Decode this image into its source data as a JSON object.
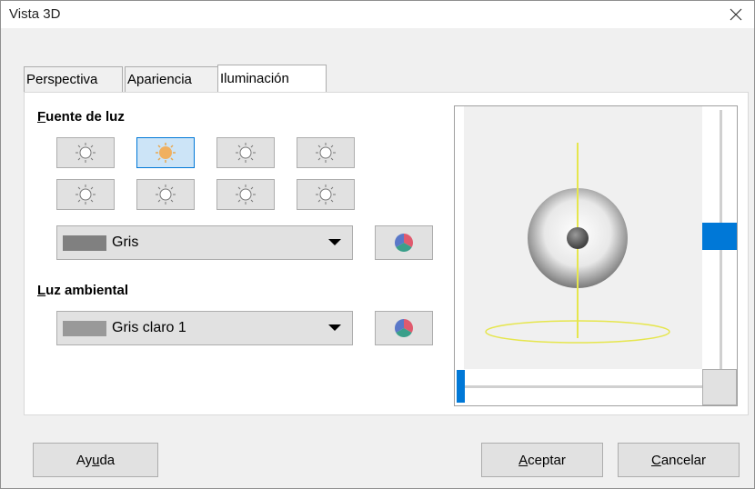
{
  "window": {
    "title": "Vista 3D"
  },
  "tabs": [
    {
      "label": "Perspectiva"
    },
    {
      "label": "Apariencia"
    },
    {
      "label": "Iluminación",
      "active": true
    }
  ],
  "light_source": {
    "label_first": "F",
    "label_rest": "uente de luz",
    "selected_index": 1,
    "color": {
      "name": "Gris",
      "swatch": "#808080"
    }
  },
  "ambient_light": {
    "label_first": "L",
    "label_rest": "uz ambiental",
    "color": {
      "name": "Gris claro 1",
      "swatch": "#999999"
    }
  },
  "buttons": {
    "help": {
      "pre": "Ay",
      "u": "u",
      "post": "da"
    },
    "accept": {
      "pre": "",
      "u": "A",
      "post": "ceptar"
    },
    "cancel": {
      "pre": "",
      "u": "C",
      "post": "ancelar"
    }
  },
  "colors": {
    "accent": "#0078d7",
    "selected_light": "#f0b060",
    "axis": "#e6e64d"
  }
}
